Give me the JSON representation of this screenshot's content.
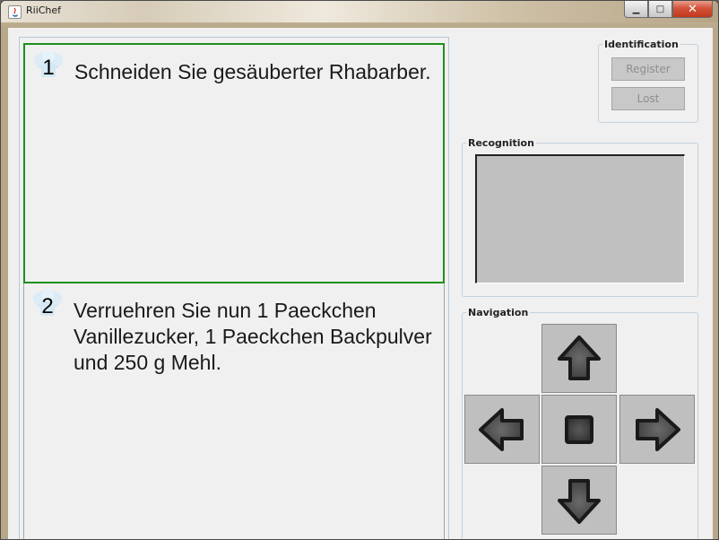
{
  "window": {
    "title": "RiiChef",
    "minimize_glyph": "▁",
    "maximize_glyph": "□",
    "close_glyph": "✕"
  },
  "steps": [
    {
      "number": "1",
      "text": "Schneiden Sie gesäuberter Rhabarber.",
      "selected": true
    },
    {
      "number": "2",
      "text": "Verruehren Sie nun 1 Paeckchen Vanillezucker, 1 Paeckchen Backpulver und 250 g Mehl.",
      "selected": false
    }
  ],
  "identification": {
    "title": "Identification",
    "register_label": "Register",
    "lost_label": "Lost"
  },
  "recognition": {
    "title": "Recognition"
  },
  "navigation": {
    "title": "Navigation",
    "icons": [
      "arrow-up-icon",
      "arrow-left-icon",
      "stop-icon",
      "arrow-right-icon",
      "arrow-down-icon"
    ]
  },
  "colors": {
    "selected_border": "#1f8f1f",
    "panel_bg": "#f0f0f0",
    "disabled_text": "#8d8d8d"
  }
}
